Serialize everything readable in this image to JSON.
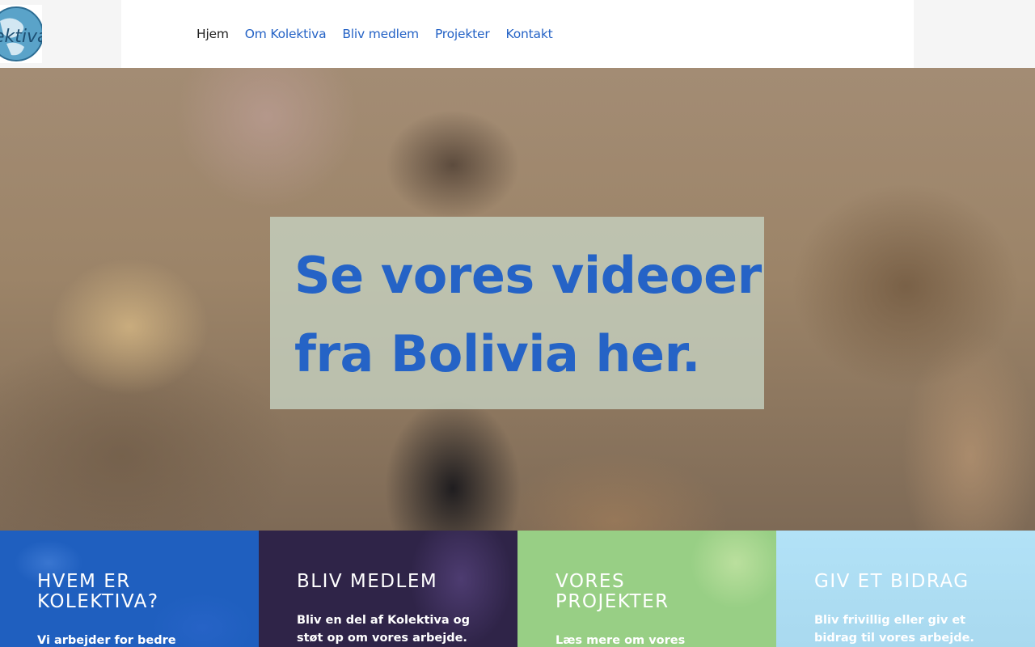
{
  "logo": {
    "text": "ektiva",
    "icon": "globe-logo-icon"
  },
  "nav": {
    "items": [
      {
        "label": "Hjem",
        "active": true
      },
      {
        "label": "Om Kolektiva",
        "active": false
      },
      {
        "label": "Bliv medlem",
        "active": false
      },
      {
        "label": "Projekter",
        "active": false
      },
      {
        "label": "Kontakt",
        "active": false
      }
    ]
  },
  "hero": {
    "line1": "Se vores videoer",
    "line2": "fra Bolivia her."
  },
  "tiles": [
    {
      "title_line1": "HVEM ER",
      "title_line2": "KOLEKTIVA?",
      "text_line1": "Vi arbejder for bedre",
      "text_line2": ""
    },
    {
      "title_line1": "BLIV MEDLEM",
      "title_line2": "",
      "text_line1": "Bliv en del af Kolektiva og",
      "text_line2": "støt op om vores arbejde."
    },
    {
      "title_line1": "VORES",
      "title_line2": "PROJEKTER",
      "text_line1": "Læs mere om vores arbejde",
      "text_line2": ""
    },
    {
      "title_line1": "GIV ET BIDRAG",
      "title_line2": "",
      "text_line1": "Bliv frivillig eller giv et",
      "text_line2": "bidrag til vores arbejde."
    }
  ],
  "colors": {
    "accent": "#2563c6",
    "tile_blue": "#1f5fbf",
    "tile_purple": "#2f2448",
    "tile_green": "#98cf85",
    "tile_sky": "#b2e2f7"
  }
}
